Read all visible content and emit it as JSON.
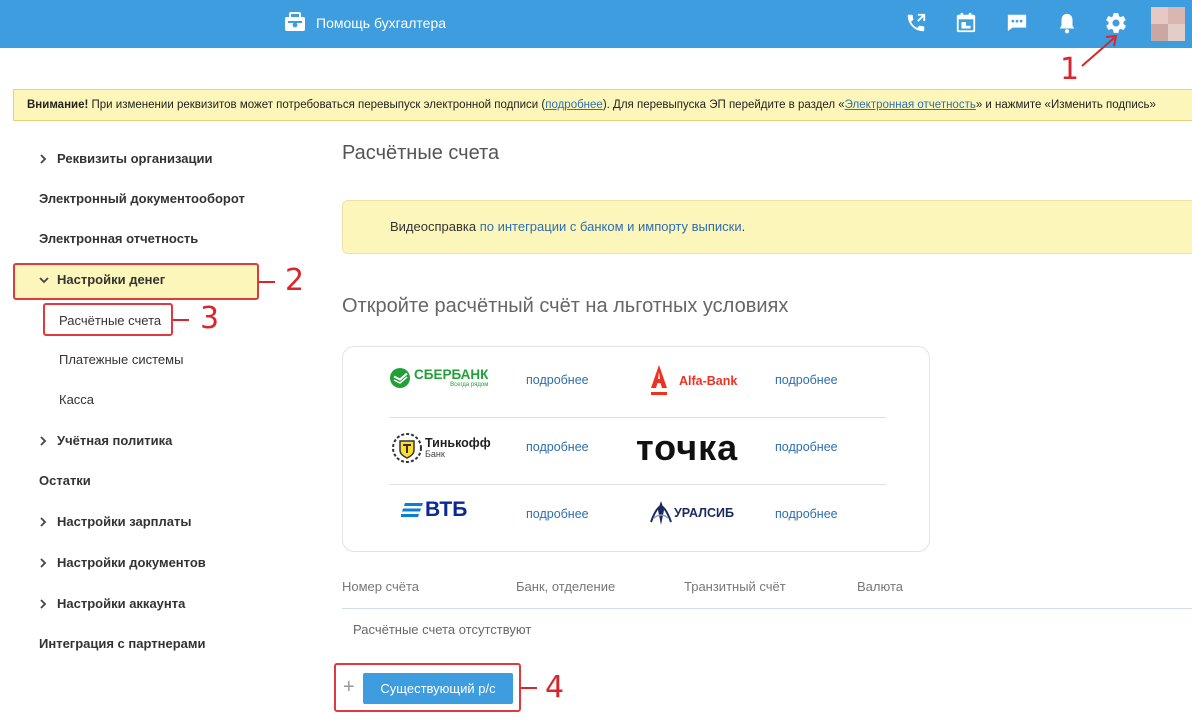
{
  "header": {
    "helper_label": "Помощь бухгалтера",
    "icons": [
      "helper-icon",
      "phone-icon",
      "calendar-icon",
      "chat-icon",
      "bell-icon",
      "gear-icon"
    ],
    "bg_color": "#3d9ddf"
  },
  "warning": {
    "bold": "Внимание!",
    "text1": " При изменении реквизитов может потребоваться перевыпуск электронной подписи (",
    "link1": "подробнее",
    "text2": "). Для перевыпуска ЭП перейдите в раздел «",
    "link2": "Электронная отчетность",
    "text3": "» и нажмите «Изменить подпись»"
  },
  "sidebar": {
    "items": [
      {
        "label": "Реквизиты организации"
      },
      {
        "label": "Электронный документооборот"
      },
      {
        "label": "Электронная отчетность"
      },
      {
        "label": "Настройки денег"
      },
      {
        "label": "Расчётные счета"
      },
      {
        "label": "Платежные системы"
      },
      {
        "label": "Касса"
      },
      {
        "label": "Учётная политика"
      },
      {
        "label": "Остатки"
      },
      {
        "label": "Настройки зарплаты"
      },
      {
        "label": "Настройки документов"
      },
      {
        "label": "Настройки аккаунта"
      },
      {
        "label": "Интеграция с партнерами"
      }
    ]
  },
  "main": {
    "title": "Расчётные счета",
    "video_prefix": "Видеосправка ",
    "video_link": "по интеграции с банком и импорту выписки",
    "video_suffix": ".",
    "promo_title": "Откройте расчётный счёт на льготных условиях",
    "banks": [
      {
        "name": "СБЕРБАНК",
        "tagline": "Всегда рядом",
        "more": "подробнее",
        "color": "#21a038"
      },
      {
        "name": "Alfa-Bank",
        "more": "подробнее",
        "color": "#ef3124"
      },
      {
        "name": "Тинькофф",
        "tagline": "Банк",
        "more": "подробнее",
        "color": "#222222"
      },
      {
        "name": "точка",
        "more": "подробнее",
        "color": "#111111"
      },
      {
        "name": "ВТБ",
        "more": "подробнее",
        "color": "#0a2896"
      },
      {
        "name": "УРАЛСИБ",
        "more": "подробнее",
        "color": "#1b2a5c"
      }
    ],
    "table": {
      "columns": [
        "Номер счёта",
        "Банк, отделение",
        "Транзитный счёт",
        "Валюта"
      ],
      "empty": "Расчётные счета отсутствуют"
    },
    "add_plus": "+",
    "add_button": "Существующий р/с"
  },
  "annotations": [
    "1",
    "2",
    "3",
    "4"
  ]
}
